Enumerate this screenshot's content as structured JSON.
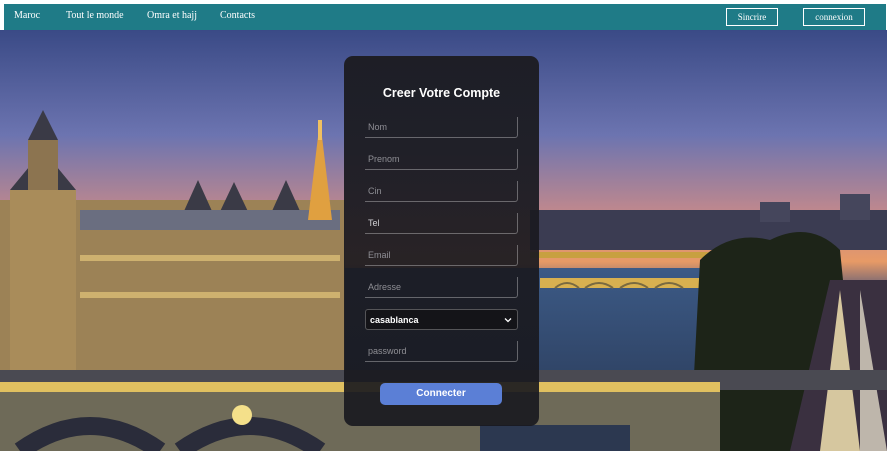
{
  "nav": {
    "links": [
      "Maroc",
      "Tout le monde",
      "Omra et hajj",
      "Contacts"
    ],
    "signup_label": "Sincrire",
    "login_label": "connexion"
  },
  "colors": {
    "nav_bg": "#1f7b87",
    "card_bg": "#1c1c22",
    "submit_bg": "#5b7fd6"
  },
  "form": {
    "title": "Creer Votre Compte",
    "fields": [
      {
        "placeholder": "Nom"
      },
      {
        "placeholder": "Prenom"
      },
      {
        "placeholder": "Cin"
      },
      {
        "placeholder": "Tel"
      },
      {
        "placeholder": "Email"
      },
      {
        "placeholder": "Adresse"
      }
    ],
    "city_select": {
      "value": "casablanca",
      "icon": "chevron-down-icon"
    },
    "password_placeholder": "password",
    "submit_label": "Connecter"
  }
}
